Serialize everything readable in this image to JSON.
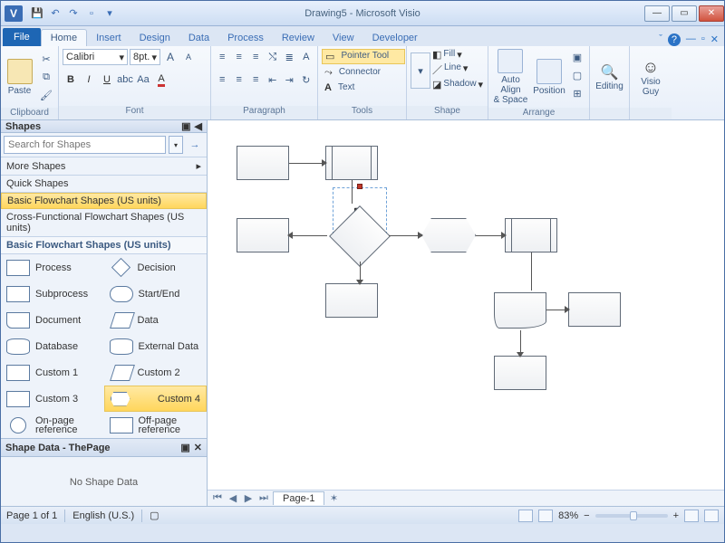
{
  "window": {
    "title": "Drawing5 - Microsoft Visio"
  },
  "qat": [
    "save",
    "undo",
    "redo",
    "print",
    "preview"
  ],
  "tabs": {
    "file": "File",
    "items": [
      "Home",
      "Insert",
      "Design",
      "Data",
      "Process",
      "Review",
      "View",
      "Developer"
    ],
    "active": "Home"
  },
  "ribbon": {
    "clipboard": {
      "paste": "Paste",
      "label": "Clipboard"
    },
    "font": {
      "name": "Calibri",
      "size": "8pt.",
      "label": "Font"
    },
    "paragraph": {
      "label": "Paragraph"
    },
    "tools": {
      "pointer": "Pointer Tool",
      "connector": "Connector",
      "text": "Text",
      "label": "Tools"
    },
    "shape": {
      "fill": "Fill",
      "line": "Line",
      "shadow": "Shadow",
      "label": "Shape"
    },
    "arrange": {
      "autoalign": "Auto Align\n& Space",
      "position": "Position",
      "label": "Arrange"
    },
    "editing": {
      "label": "Editing"
    },
    "visioguy": {
      "label": "Visio\nGuy"
    }
  },
  "shapes_panel": {
    "title": "Shapes",
    "search_placeholder": "Search for Shapes",
    "sections": [
      "More Shapes",
      "Quick Shapes",
      "Basic Flowchart Shapes (US units)",
      "Cross-Functional Flowchart Shapes (US units)"
    ],
    "selected_section": "Basic Flowchart Shapes (US units)",
    "stencil_title": "Basic Flowchart Shapes (US units)",
    "stencil": [
      {
        "label": "Process",
        "g": "rect"
      },
      {
        "label": "Decision",
        "g": "decision"
      },
      {
        "label": "Subprocess",
        "g": "rect"
      },
      {
        "label": "Start/End",
        "g": "startend"
      },
      {
        "label": "Document",
        "g": "document"
      },
      {
        "label": "Data",
        "g": "data"
      },
      {
        "label": "Database",
        "g": "db"
      },
      {
        "label": "External Data",
        "g": "db"
      },
      {
        "label": "Custom 1",
        "g": "rect"
      },
      {
        "label": "Custom 2",
        "g": "data"
      },
      {
        "label": "Custom 3",
        "g": "rect"
      },
      {
        "label": "Custom 4",
        "g": "hex"
      },
      {
        "label": "On-page\nreference",
        "g": "circle"
      },
      {
        "label": "Off-page\nreference",
        "g": "rect"
      }
    ],
    "selected_shape": "Custom 4"
  },
  "shapedata": {
    "title": "Shape Data - ThePage",
    "empty": "No Shape Data"
  },
  "page_tabs": {
    "active": "Page-1"
  },
  "status": {
    "page": "Page 1 of 1",
    "lang": "English (U.S.)",
    "zoom": "83%"
  }
}
